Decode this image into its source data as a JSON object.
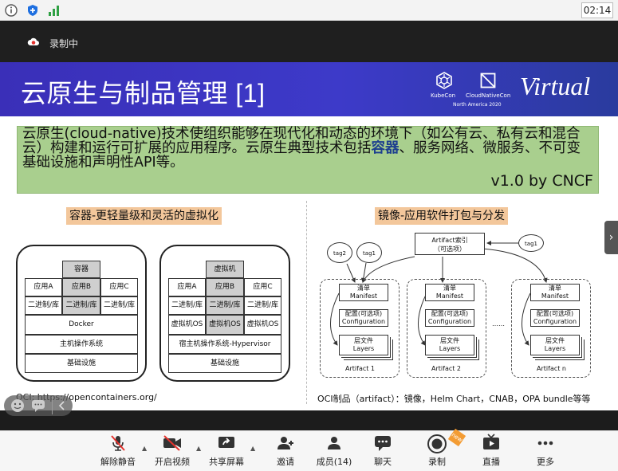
{
  "status_bar": {
    "time": "02:14",
    "icons": [
      "info-icon",
      "shield-icon",
      "signal-icon"
    ]
  },
  "recording": {
    "label": "录制中",
    "icon": "cloud-recording-icon"
  },
  "slide": {
    "title": "云原生与制品管理 [1]",
    "logos": {
      "kubecon": "KubeCon",
      "cncf": "CloudNativeCon",
      "sub": "North America 2020",
      "virtual": "Virtual"
    },
    "intro_pre": "云原生(cloud-native)技术使组织能够在现代化和动态的环境下（如公有云、私有云和混合云）构建和运行可扩展的应用程序。云原生典型技术包括",
    "intro_hl": "容器",
    "intro_post": "、服务网络、微服务、不可变基础设施和声明性API等。",
    "version": "v1.0 by CNCF",
    "container_label": "容器-更轻量级和灵活的虚拟化",
    "image_label": "镜像-应用软件打包与分发",
    "container_diagram": {
      "rongqi": "容器",
      "app_a": "应用A",
      "app_b": "应用B",
      "app_c": "应用C",
      "bin": "二进制/库",
      "docker": "Docker",
      "host_os": "主机操作系统",
      "infra": "基础设施"
    },
    "vm_diagram": {
      "vm": "虚拟机",
      "app_a": "应用A",
      "app_b": "应用B",
      "app_c": "应用C",
      "bin": "二进制/库",
      "vm_os": "虚拟机OS",
      "hypervisor": "宿主机操作系统-Hypervisor",
      "infra": "基础设施"
    },
    "artifact_diagram": {
      "index": "Artifact索引",
      "optional": "（可选项）",
      "tags": [
        "tag2",
        "tag1",
        "tag1"
      ],
      "manifest_cn": "清单",
      "manifest_en": "Manifest",
      "config_cn": "配置(可选项)",
      "config_en": "Configuration",
      "layers_cn": "层文件",
      "layers_en": "Layers",
      "artifacts": [
        "Artifact 1",
        "Artifact 2",
        "Artifact n"
      ],
      "dots": "……"
    },
    "oci_left": "OCI: https://opencontainers.org/",
    "oci_right": "OCI制品（artifact）：镜像，Helm Chart，CNAB，OPA bundle等等"
  },
  "toolbar": {
    "items": [
      {
        "label": "解除静音",
        "icon": "mic-muted-icon"
      },
      {
        "label": "开启视频",
        "icon": "video-off-icon"
      },
      {
        "label": "共享屏幕",
        "icon": "share-screen-icon"
      },
      {
        "label": "邀请",
        "icon": "invite-icon"
      },
      {
        "label": "成员(14)",
        "icon": "participants-icon"
      },
      {
        "label": "聊天",
        "icon": "chat-icon"
      },
      {
        "label": "录制",
        "icon": "record-icon"
      },
      {
        "label": "直播",
        "icon": "live-icon"
      },
      {
        "label": "更多",
        "icon": "more-icon"
      }
    ],
    "new_badge": "new"
  },
  "colors": {
    "banner": "#3d3ac9",
    "intro_bg": "#a9cf8e",
    "label_bg": "#f3c79b",
    "highlight": "#1d3f8f"
  }
}
